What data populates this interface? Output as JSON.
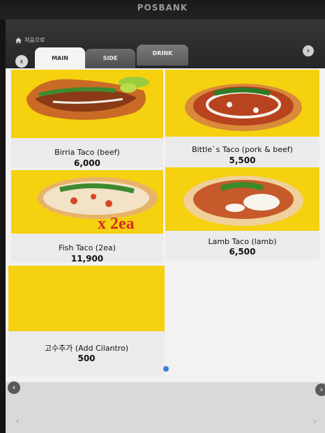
{
  "device": {
    "brand": "POSBANK"
  },
  "header": {
    "home_label": "처음으로",
    "tabs": [
      {
        "label": "MAIN",
        "active": true
      },
      {
        "label": "SIDE",
        "active": false
      },
      {
        "label": "DRINK",
        "active": false
      }
    ]
  },
  "menu": {
    "items": [
      {
        "name": "Birria Taco (beef)",
        "price": "6,000",
        "image": "birria-taco-photo"
      },
      {
        "name": "Bittle`s Taco (pork & beef)",
        "price": "5,500",
        "image": "bittles-taco-photo"
      },
      {
        "name": "Fish Taco (2ea)",
        "price": "11,900",
        "image": "fish-taco-photo",
        "overlay": "x 2ea"
      },
      {
        "name": "Lamb Taco (lamb)",
        "price": "6,500",
        "image": "lamb-taco-photo"
      },
      {
        "name": "고수추가 (Add Cilantro)",
        "price": "500",
        "image": "blank-yellow"
      }
    ]
  },
  "pagination": {
    "current_page": 1,
    "total_pages": 1
  },
  "colors": {
    "photo_background": "#f5d10f",
    "accent_dot": "#3d7fd6",
    "active_tab": "#f4f4f4"
  },
  "icons": [
    "home-icon",
    "chevron-left-icon",
    "chevron-right-icon"
  ]
}
